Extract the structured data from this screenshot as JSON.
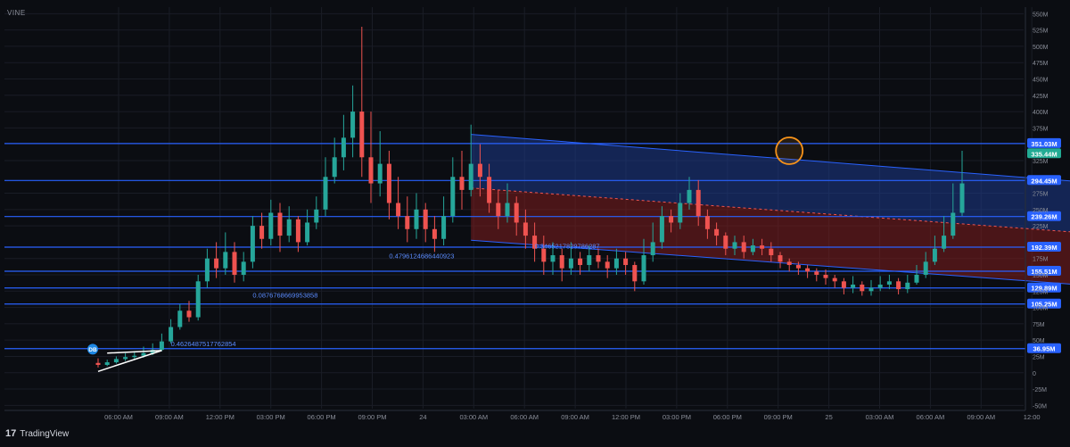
{
  "symbol": "VINE",
  "branding": {
    "mark": "17",
    "name": "TradingView"
  },
  "colors": {
    "background": "#0b0d12",
    "grid": "#1a1d26",
    "up": "#26a69a",
    "down": "#ef5350",
    "level_line": "#2962ff",
    "channel_upper_fill": "#1e3a8a",
    "channel_lower_fill": "#7f1d1d",
    "circle": "#f7931a",
    "last_price_bg": "#22ab94"
  },
  "chart_data": {
    "type": "candlestick",
    "y_unit": "M",
    "ylim": [
      -55,
      560
    ],
    "y_ticks": [
      550,
      525,
      500,
      475,
      450,
      425,
      400,
      375,
      325,
      275,
      250,
      225,
      175,
      150,
      125,
      100,
      75,
      50,
      25,
      0,
      -25,
      -50
    ],
    "y_tick_labels": [
      "550M",
      "525M",
      "500M",
      "475M",
      "450M",
      "425M",
      "400M",
      "375M",
      "325M",
      "275M",
      "250M",
      "225M",
      "175M",
      "150M",
      "125M",
      "100M",
      "75M",
      "50M",
      "25M",
      "0",
      "-25M",
      "-50M"
    ],
    "x_ticks": [
      "06:00 AM",
      "09:00 AM",
      "12:00 PM",
      "03:00 PM",
      "06:00 PM",
      "09:00 PM",
      "24",
      "03:00 AM",
      "06:00 AM",
      "09:00 AM",
      "12:00 PM",
      "03:00 PM",
      "06:00 PM",
      "09:00 PM",
      "25",
      "03:00 AM",
      "06:00 AM",
      "09:00 AM",
      "12:00"
    ],
    "horizontal_levels": [
      {
        "value": 351.03,
        "label": "351.03M"
      },
      {
        "value": 294.45,
        "label": "294.45M"
      },
      {
        "value": 239.26,
        "label": "239.26M"
      },
      {
        "value": 192.39,
        "label": "192.39M"
      },
      {
        "value": 155.51,
        "label": "155.51M"
      },
      {
        "value": 129.89,
        "label": "129.89M"
      },
      {
        "value": 105.25,
        "label": "105.25M"
      },
      {
        "value": 36.95,
        "label": "36.95M"
      }
    ],
    "last_price": {
      "value": 335.44,
      "label": "335.44M"
    },
    "channel": {
      "x_start": 42,
      "x_end": 202,
      "upper": [
        365,
        192
      ],
      "middle": [
        283,
        120
      ],
      "lower": [
        203,
        40
      ]
    },
    "fib_labels": [
      {
        "text": "0.4626487517762854",
        "x": 9,
        "y": 41
      },
      {
        "text": "0.0876768669953858",
        "x": 18,
        "y": 115
      },
      {
        "text": "0.4796124686440923",
        "x": 33,
        "y": 175
      },
      {
        "text": "0.3465217829786287",
        "x": 49,
        "y": 190
      }
    ],
    "marker_badge": {
      "text": "DB",
      "x": 0,
      "y": 36
    },
    "highlight_circles": [
      {
        "x": 77,
        "y": 340
      },
      {
        "x": 121,
        "y": 284
      },
      {
        "x": 178,
        "y": 112
      },
      {
        "x": 190,
        "y": 113
      },
      {
        "x": 199,
        "y": 185
      }
    ],
    "candles": [
      [
        1,
        15,
        12,
        22,
        8
      ],
      [
        2,
        12,
        16,
        20,
        10
      ],
      [
        3,
        16,
        21,
        25,
        14
      ],
      [
        4,
        21,
        24,
        30,
        18
      ],
      [
        5,
        24,
        26,
        33,
        20
      ],
      [
        6,
        26,
        30,
        40,
        23
      ],
      [
        7,
        30,
        35,
        45,
        27
      ],
      [
        8,
        35,
        48,
        60,
        33
      ],
      [
        9,
        48,
        70,
        82,
        45
      ],
      [
        10,
        70,
        95,
        105,
        66
      ],
      [
        11,
        95,
        85,
        110,
        78
      ],
      [
        12,
        85,
        140,
        150,
        80
      ],
      [
        13,
        140,
        175,
        190,
        130
      ],
      [
        14,
        175,
        160,
        200,
        145
      ],
      [
        15,
        160,
        185,
        215,
        150
      ],
      [
        16,
        185,
        150,
        200,
        138
      ],
      [
        17,
        150,
        170,
        185,
        140
      ],
      [
        18,
        170,
        225,
        240,
        160
      ],
      [
        19,
        225,
        205,
        245,
        190
      ],
      [
        20,
        205,
        245,
        265,
        195
      ],
      [
        21,
        245,
        210,
        260,
        185
      ],
      [
        22,
        210,
        235,
        255,
        200
      ],
      [
        23,
        235,
        200,
        240,
        185
      ],
      [
        24,
        200,
        230,
        250,
        195
      ],
      [
        25,
        230,
        250,
        270,
        220
      ],
      [
        26,
        250,
        300,
        330,
        240
      ],
      [
        27,
        300,
        330,
        360,
        290
      ],
      [
        28,
        330,
        360,
        395,
        310
      ],
      [
        29,
        360,
        400,
        440,
        330
      ],
      [
        30,
        400,
        330,
        530,
        300
      ],
      [
        31,
        330,
        290,
        400,
        260
      ],
      [
        32,
        290,
        320,
        370,
        270
      ],
      [
        33,
        320,
        260,
        340,
        235
      ],
      [
        34,
        260,
        240,
        300,
        220
      ],
      [
        35,
        240,
        220,
        270,
        200
      ],
      [
        36,
        220,
        250,
        275,
        205
      ],
      [
        37,
        250,
        220,
        260,
        200
      ],
      [
        38,
        220,
        205,
        240,
        185
      ],
      [
        39,
        205,
        240,
        270,
        195
      ],
      [
        40,
        240,
        300,
        330,
        230
      ],
      [
        41,
        300,
        280,
        340,
        250
      ],
      [
        42,
        280,
        320,
        380,
        270
      ],
      [
        43,
        320,
        300,
        350,
        270
      ],
      [
        44,
        300,
        260,
        320,
        245
      ],
      [
        45,
        260,
        240,
        280,
        220
      ],
      [
        46,
        240,
        260,
        290,
        230
      ],
      [
        47,
        260,
        230,
        270,
        210
      ],
      [
        48,
        230,
        210,
        250,
        190
      ],
      [
        49,
        210,
        190,
        230,
        170
      ],
      [
        50,
        190,
        170,
        210,
        150
      ],
      [
        51,
        170,
        180,
        200,
        150
      ],
      [
        52,
        180,
        160,
        190,
        140
      ],
      [
        53,
        160,
        175,
        200,
        150
      ],
      [
        54,
        175,
        165,
        185,
        150
      ],
      [
        55,
        165,
        180,
        195,
        155
      ],
      [
        56,
        180,
        170,
        190,
        160
      ],
      [
        57,
        170,
        160,
        180,
        145
      ],
      [
        58,
        160,
        175,
        190,
        150
      ],
      [
        59,
        175,
        165,
        185,
        150
      ],
      [
        60,
        165,
        140,
        170,
        125
      ],
      [
        61,
        140,
        180,
        205,
        135
      ],
      [
        62,
        180,
        200,
        230,
        170
      ],
      [
        63,
        200,
        240,
        255,
        190
      ],
      [
        64,
        240,
        230,
        250,
        215
      ],
      [
        65,
        230,
        260,
        275,
        220
      ],
      [
        66,
        260,
        280,
        300,
        250
      ],
      [
        67,
        280,
        240,
        295,
        225
      ],
      [
        68,
        240,
        220,
        250,
        205
      ],
      [
        69,
        220,
        210,
        230,
        195
      ],
      [
        70,
        210,
        190,
        215,
        180
      ],
      [
        71,
        190,
        200,
        210,
        180
      ],
      [
        72,
        200,
        185,
        210,
        175
      ],
      [
        73,
        185,
        195,
        205,
        180
      ],
      [
        74,
        195,
        190,
        205,
        180
      ],
      [
        75,
        190,
        180,
        200,
        170
      ],
      [
        76,
        180,
        170,
        185,
        160
      ],
      [
        77,
        170,
        165,
        175,
        155
      ],
      [
        78,
        165,
        160,
        170,
        150
      ],
      [
        79,
        160,
        155,
        165,
        145
      ],
      [
        80,
        155,
        150,
        160,
        140
      ],
      [
        81,
        150,
        145,
        158,
        135
      ],
      [
        82,
        145,
        140,
        150,
        130
      ],
      [
        83,
        140,
        130,
        145,
        120
      ],
      [
        84,
        130,
        135,
        148,
        122
      ],
      [
        85,
        135,
        125,
        140,
        118
      ],
      [
        86,
        125,
        130,
        142,
        118
      ],
      [
        87,
        130,
        135,
        148,
        125
      ],
      [
        88,
        135,
        140,
        150,
        128
      ],
      [
        89,
        140,
        128,
        145,
        120
      ],
      [
        90,
        128,
        138,
        150,
        122
      ],
      [
        91,
        138,
        150,
        165,
        135
      ],
      [
        92,
        150,
        170,
        185,
        145
      ],
      [
        93,
        170,
        190,
        210,
        165
      ],
      [
        94,
        190,
        210,
        240,
        185
      ],
      [
        95,
        210,
        245,
        290,
        205
      ],
      [
        96,
        245,
        290,
        340,
        240
      ]
    ]
  }
}
